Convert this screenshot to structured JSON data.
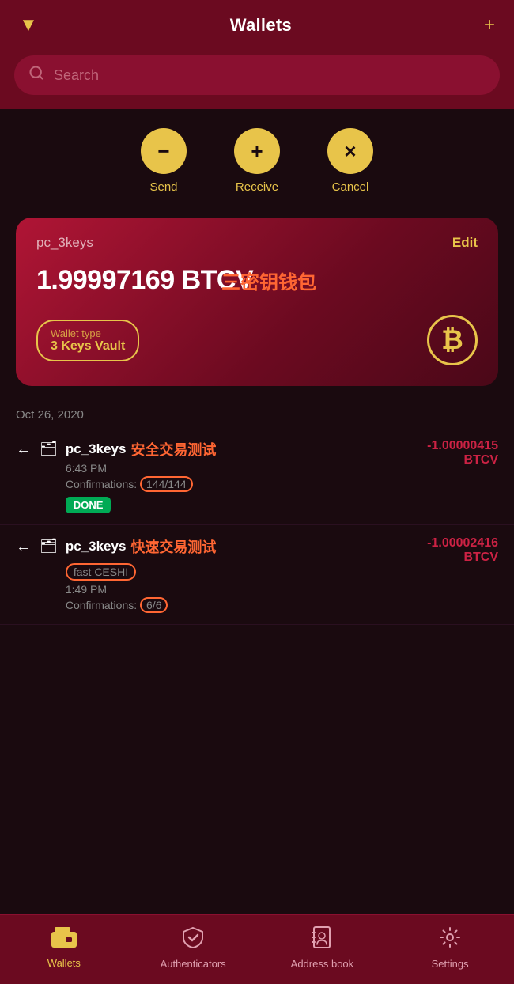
{
  "header": {
    "title": "Wallets",
    "filter_icon": "▼",
    "add_icon": "+"
  },
  "search": {
    "placeholder": "Search"
  },
  "actions": [
    {
      "id": "send",
      "icon": "−",
      "label": "Send"
    },
    {
      "id": "receive",
      "icon": "+",
      "label": "Receive"
    },
    {
      "id": "cancel",
      "icon": "×",
      "label": "Cancel"
    }
  ],
  "wallet_card": {
    "name": "pc_3keys",
    "edit_label": "Edit",
    "balance": "1.99997169 BTCV",
    "type_label": "Wallet type",
    "type_value": "3 Keys Vault",
    "btc_symbol": "₿",
    "annotation": "三密钥钱包"
  },
  "date_label": "Oct 26, 2020",
  "transactions": [
    {
      "id": "tx1",
      "direction": "←",
      "wallet_icon": "🗂",
      "wallet_name": "pc_3keys",
      "annotation": "安全交易测试",
      "time": "6:43 PM",
      "confirmations_label": "Confirmations:",
      "confirmations_value": "144/144",
      "status": "DONE",
      "amount": "-1.00000415",
      "currency": "BTCV"
    },
    {
      "id": "tx2",
      "direction": "←",
      "wallet_icon": "🗂",
      "wallet_name": "pc_3keys",
      "annotation": "快速交易测试",
      "fast_label": "fast CESHI",
      "time": "1:49 PM",
      "confirmations_label": "Confirmations:",
      "confirmations_value": "6/6",
      "amount": "-1.00002416",
      "currency": "BTCV"
    }
  ],
  "bottom_nav": [
    {
      "id": "wallets",
      "icon": "wallet",
      "label": "Wallets",
      "active": true
    },
    {
      "id": "authenticators",
      "icon": "shield",
      "label": "Authenticators",
      "active": false
    },
    {
      "id": "address-book",
      "icon": "book",
      "label": "Address book",
      "active": false
    },
    {
      "id": "settings",
      "icon": "gear",
      "label": "Settings",
      "active": false
    }
  ]
}
